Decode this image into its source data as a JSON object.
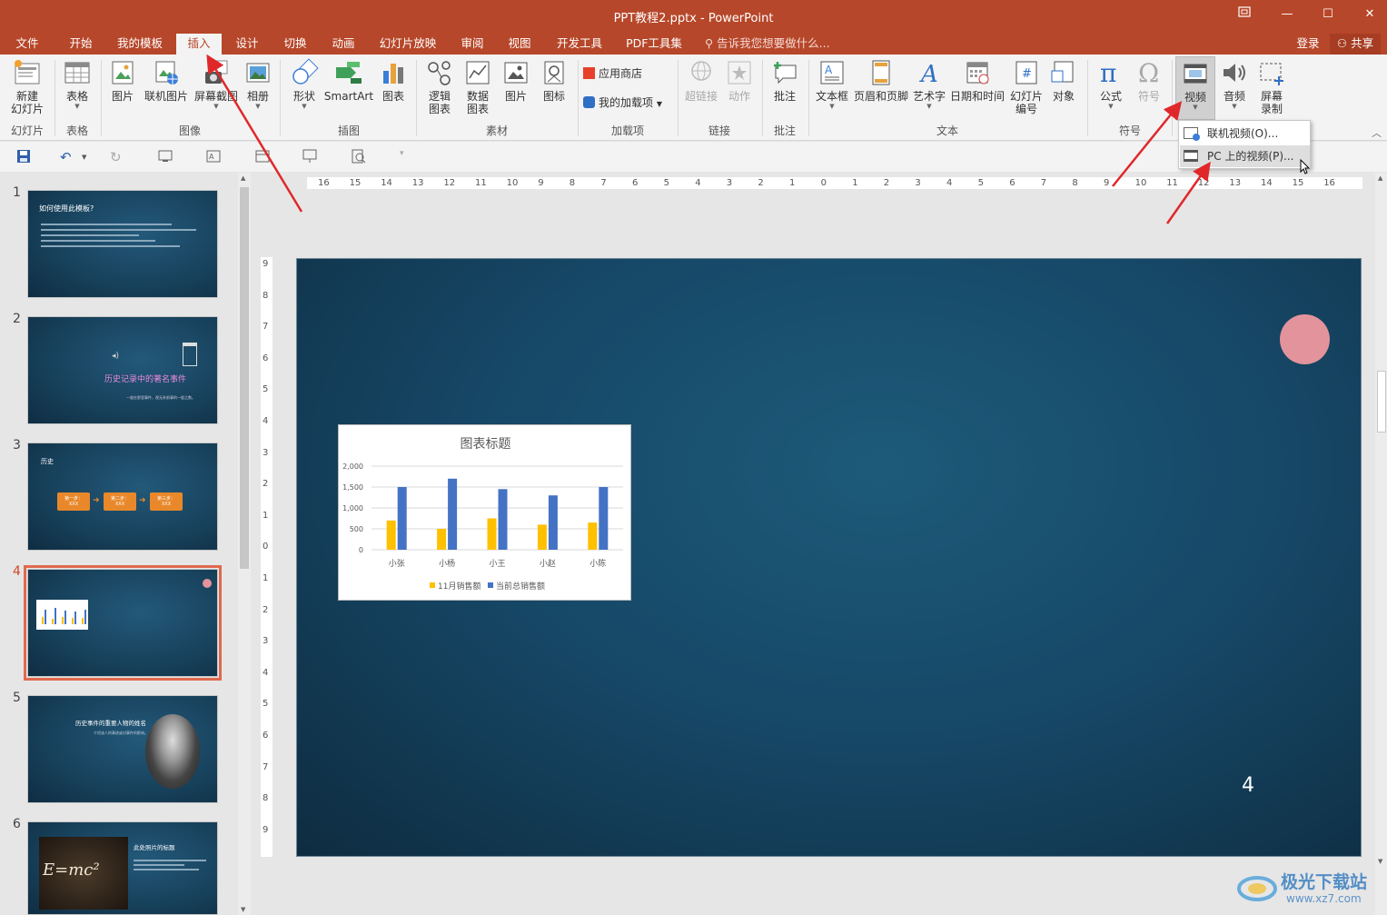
{
  "window": {
    "title": "PPT教程2.pptx - PowerPoint",
    "restore_icon": "restore-ribbon-icon",
    "minimize": "—",
    "maximize": "☐",
    "close": "✕"
  },
  "tabs": [
    "文件",
    "开始",
    "我的模板",
    "插入",
    "设计",
    "切换",
    "动画",
    "幻灯片放映",
    "审阅",
    "视图",
    "开发工具",
    "PDF工具集"
  ],
  "active_tab": "插入",
  "tell_me": "告诉我您想要做什么...",
  "account": {
    "login": "登录",
    "share": "共享"
  },
  "ribbon": {
    "slides": {
      "new_slide": "新建",
      "new_slide2": "幻灯片",
      "group": "幻灯片"
    },
    "table": {
      "table": "表格",
      "group": "表格"
    },
    "images": {
      "picture": "图片",
      "online_picture": "联机图片",
      "screenshot": "屏幕截图",
      "album": "相册",
      "group": "图像"
    },
    "illustrations": {
      "shapes": "形状",
      "smartart": "SmartArt",
      "chart": "图表",
      "group": "插图"
    },
    "material": {
      "logic": "逻辑",
      "logic2": "图表",
      "data": "数据",
      "data2": "图表",
      "picture": "图片",
      "icon": "图标",
      "group": "素材"
    },
    "addins": {
      "store": "应用商店",
      "my_addins": "我的加载项",
      "group": "加载项"
    },
    "links": {
      "hyperlink": "超链接",
      "action": "动作",
      "group": "链接"
    },
    "comments": {
      "comment": "批注",
      "group": "批注"
    },
    "text": {
      "textbox": "文本框",
      "header_footer": "页眉和页脚",
      "wordart": "艺术字",
      "datetime": "日期和时间",
      "slide_number": "幻灯片",
      "slide_number2": "编号",
      "object": "对象",
      "group": "文本"
    },
    "symbols": {
      "equation": "公式",
      "symbol": "符号",
      "group": "符号"
    },
    "media": {
      "video": "视频",
      "audio": "音频",
      "screen_record": "屏幕",
      "screen_record2": "录制"
    }
  },
  "video_menu": {
    "online": "联机视频(O)...",
    "pc": "PC 上的视频(P)..."
  },
  "ruler": {
    "h": [
      "16",
      "15",
      "14",
      "13",
      "12",
      "11",
      "10",
      "9",
      "8",
      "7",
      "6",
      "5",
      "4",
      "3",
      "2",
      "1",
      "0",
      "1",
      "2",
      "3",
      "4",
      "5",
      "6",
      "7",
      "8",
      "9",
      "10",
      "11",
      "12",
      "13",
      "14",
      "15",
      "16"
    ],
    "v": [
      "9",
      "8",
      "7",
      "6",
      "5",
      "4",
      "3",
      "2",
      "1",
      "0",
      "1",
      "2",
      "3",
      "4",
      "5",
      "6",
      "7",
      "8",
      "9"
    ]
  },
  "thumbnails": [
    {
      "num": "1",
      "title": "如何使用此模板?"
    },
    {
      "num": "2",
      "title": "历史记录中的著名事件",
      "sub": "一般在那里事件，视无补前事的一般之数。"
    },
    {
      "num": "3",
      "title": "历史",
      "steps": [
        "第一步：",
        "第二步：",
        "第三步："
      ],
      "step_sub": "XXX"
    },
    {
      "num": "4"
    },
    {
      "num": "5",
      "title": "历史事件的重要人物的姓名",
      "sub": "介绍该人的事迹或对事件的影响。"
    },
    {
      "num": "6",
      "title": "此处照片的标题",
      "formula": "E=mc²"
    }
  ],
  "slide": {
    "page_number": "4"
  },
  "chart_data": {
    "type": "bar",
    "title": "图表标题",
    "categories": [
      "小张",
      "小杨",
      "小王",
      "小赵",
      "小陈"
    ],
    "series": [
      {
        "name": "11月销售额",
        "color": "#ffc000",
        "values": [
          700,
          500,
          750,
          600,
          650
        ]
      },
      {
        "name": "当前总销售额",
        "color": "#4472c4",
        "values": [
          1500,
          1700,
          1450,
          1300,
          1500
        ]
      }
    ],
    "ylim": [
      0,
      2000
    ],
    "yticks": [
      "2,000",
      "1,500",
      "1,000",
      "500",
      "0"
    ],
    "legend": "bottom",
    "grid": true
  },
  "watermark": {
    "text": "极光下载站",
    "url": "www.xz7.com"
  },
  "colors": {
    "accent": "#b7472a",
    "slide_bg": "#164766",
    "annotation": "#e0282a",
    "dot": "#e3939c"
  }
}
